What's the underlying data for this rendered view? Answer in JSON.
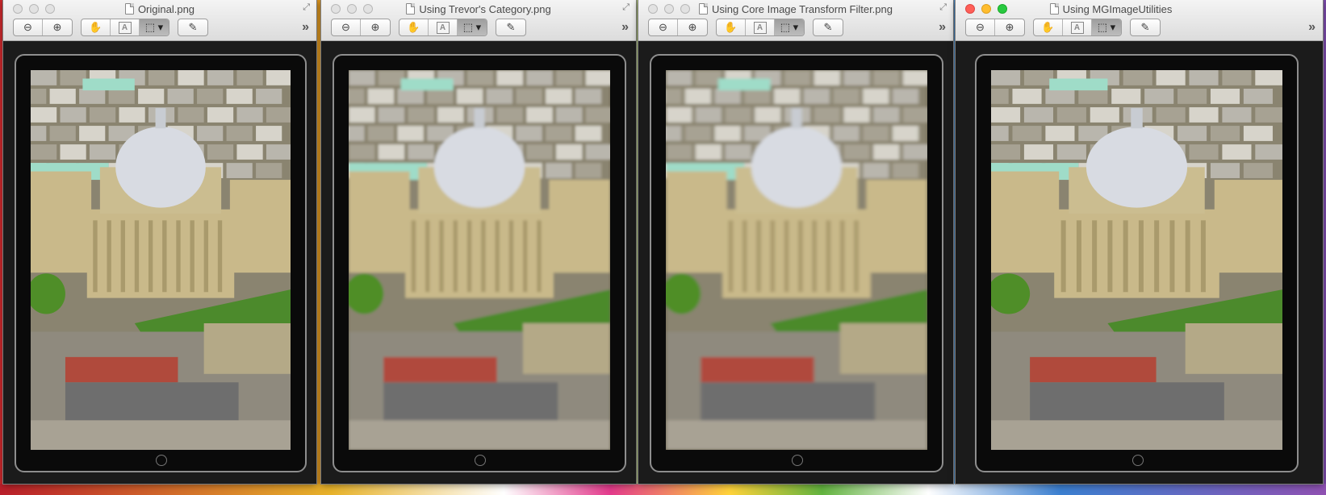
{
  "desktop": {
    "accent_colors": [
      "#c9282c",
      "#e0a020",
      "#9bc238",
      "#3f8fd0",
      "#7a4aa8"
    ]
  },
  "windows": [
    {
      "title": "Original.png",
      "active": false,
      "blur": 0.0
    },
    {
      "title": "Using Trevor's Category.png",
      "active": false,
      "blur": 1.6
    },
    {
      "title": "Using Core Image Transform Filter.png",
      "active": false,
      "blur": 1.9
    },
    {
      "title": "Using MGImageUtilities",
      "active": true,
      "blur": 0.0
    }
  ],
  "toolbar": {
    "icons": [
      "zoom-out-icon",
      "zoom-in-icon",
      "hand-tool-icon",
      "text-select-icon",
      "rect-select-icon",
      "pen-annotate-icon"
    ],
    "zoom_out_glyph": "⊖",
    "zoom_in_glyph": "⊕",
    "hand_glyph": "✋",
    "text_glyph": "A",
    "select_glyph": "⬚ ▾",
    "pen_glyph": "✎",
    "overflow_glyph": "»"
  },
  "image_description_colors": {
    "dome": "#d8dbe2",
    "stone": "#c9b98a",
    "lawn": "#4c8a2c",
    "roof": "#6e6e6e",
    "brick": "#b04a3c",
    "mint_roof": "#9fdcc8"
  }
}
